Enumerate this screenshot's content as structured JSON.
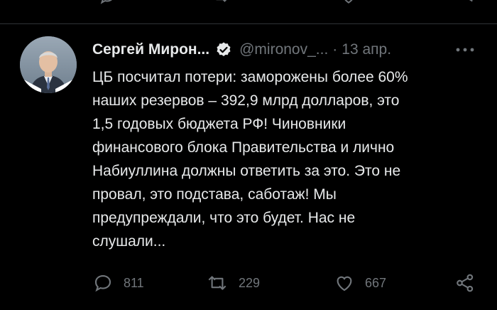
{
  "tweet": {
    "author": {
      "display_name": "Сергей Мирон...",
      "handle": "@mironov_...",
      "verified": true,
      "avatar_icon": "avatar-photo"
    },
    "separator": "·",
    "date": "13 апр.",
    "text": "ЦБ посчитал потери: заморожены более 60%\nнаших резервов – 392,9 млрд долларов, это\n1,5 годовых бюджета РФ! Чиновники\nфинансового блока Правительства и лично\nНабиуллина должны ответить за это. Это не\nпровал, это подстава, саботаж! Мы\nпредупреждали, что это будет. Нас не\nслушали...",
    "actions": {
      "reply": {
        "icon": "reply-icon",
        "count": "811"
      },
      "retweet": {
        "icon": "retweet-icon",
        "count": "229"
      },
      "like": {
        "icon": "heart-icon",
        "count": "667"
      },
      "share": {
        "icon": "share-icon"
      }
    }
  },
  "colors": {
    "background": "#000000",
    "text": "#e7e9ea",
    "muted": "#71767b",
    "divider": "#2f3336",
    "verified_badge": "#e7e9ea"
  }
}
